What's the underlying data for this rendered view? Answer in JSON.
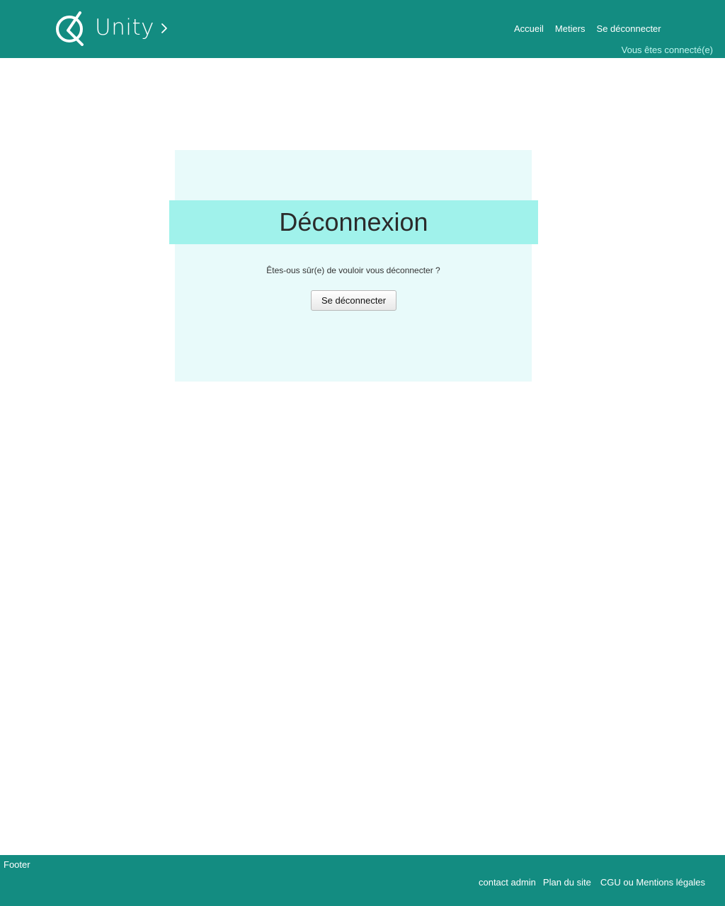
{
  "header": {
    "logo_text": "Unity",
    "logo_icon": "unity-q-icon",
    "logo_chevron_icon": "chevron-right-icon",
    "nav": [
      {
        "label": "Accueil"
      },
      {
        "label": "Metiers"
      },
      {
        "label": "Se déconnecter"
      }
    ],
    "status": "Vous êtes connecté(e)"
  },
  "main": {
    "title": "Déconnexion",
    "confirm_text": "Êtes-ous sûr(e) de vouloir vous déconnecter ?",
    "logout_button": "Se déconnecter"
  },
  "footer": {
    "label": "Footer",
    "links": [
      {
        "label": "contact admin"
      },
      {
        "label": "Plan du site"
      },
      {
        "label": "CGU ou Mentions légales"
      }
    ]
  },
  "colors": {
    "brand": "#138c81",
    "panel_bg": "#e8fafa",
    "title_band": "#a0f2eb"
  }
}
